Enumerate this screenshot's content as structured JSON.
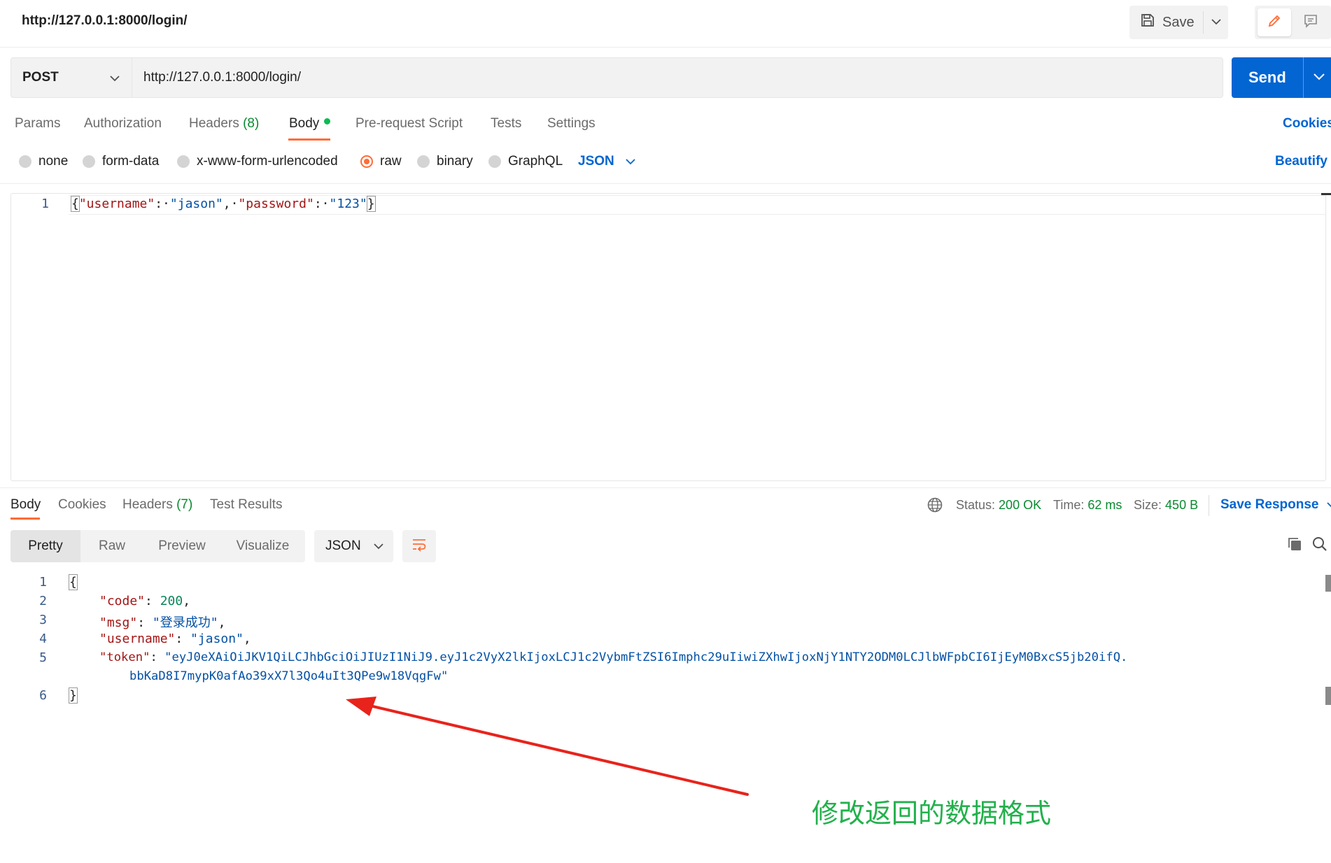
{
  "header": {
    "title": "http://127.0.0.1:8000/login/",
    "save_label": "Save"
  },
  "request": {
    "method": "POST",
    "url": "http://127.0.0.1:8000/login/",
    "send_label": "Send",
    "tabs": {
      "params": "Params",
      "authorization": "Authorization",
      "headers": "Headers",
      "headers_count": "(8)",
      "body": "Body",
      "pre_request": "Pre-request Script",
      "tests": "Tests",
      "settings": "Settings"
    },
    "cookies_label": "Cookies",
    "body_types": {
      "none": "none",
      "form_data": "form-data",
      "urlencoded": "x-www-form-urlencoded",
      "raw": "raw",
      "binary": "binary",
      "graphql": "GraphQL"
    },
    "selected_body_type": "raw",
    "language": "JSON",
    "beautify_label": "Beautify",
    "editor": {
      "line_number": "1",
      "key_username": "\"username\"",
      "value_username": "\"jason\"",
      "key_password": "\"password\"",
      "value_password": "\"123\""
    }
  },
  "response": {
    "tabs": {
      "body": "Body",
      "cookies": "Cookies",
      "headers": "Headers",
      "headers_count": "(7)",
      "test_results": "Test Results"
    },
    "status_label": "Status:",
    "status_value": "200 OK",
    "time_label": "Time:",
    "time_value": "62 ms",
    "size_label": "Size:",
    "size_value": "450 B",
    "save_response_label": "Save Response",
    "view_modes": {
      "pretty": "Pretty",
      "raw": "Raw",
      "preview": "Preview",
      "visualize": "Visualize"
    },
    "format": "JSON",
    "lines": {
      "n1": "1",
      "n2": "2",
      "n3": "3",
      "n4": "4",
      "n5": "5",
      "n6": "6",
      "code_key": "\"code\"",
      "code_value": "200",
      "msg_key": "\"msg\"",
      "msg_value": "\"登录成功\"",
      "username_key": "\"username\"",
      "username_value": "\"jason\"",
      "token_key": "\"token\"",
      "token_value_part1": "\"eyJ0eXAiOiJKV1QiLCJhbGciOiJIUzI1NiJ9.eyJ1c2VyX2lkIjoxLCJ1c2VybmFtZSI6Imphc29uIiwiZXhwIjoxNjY1NTY2ODM0LCJlbWFpbCI6IjEyM0BxcS5jb20ifQ.",
      "token_value_part2": "bbKaD8I7mypK0afAo39xX7l3Qo4uIt3QPe9w18VqgFw\""
    }
  },
  "annotation": {
    "text": "修改返回的数据格式"
  },
  "colors": {
    "accent_orange": "#ff6c37",
    "primary_blue": "#0265d2",
    "status_green": "#0a8a30",
    "annotation_green": "#22b14c",
    "arrow_red": "#e8231b"
  }
}
